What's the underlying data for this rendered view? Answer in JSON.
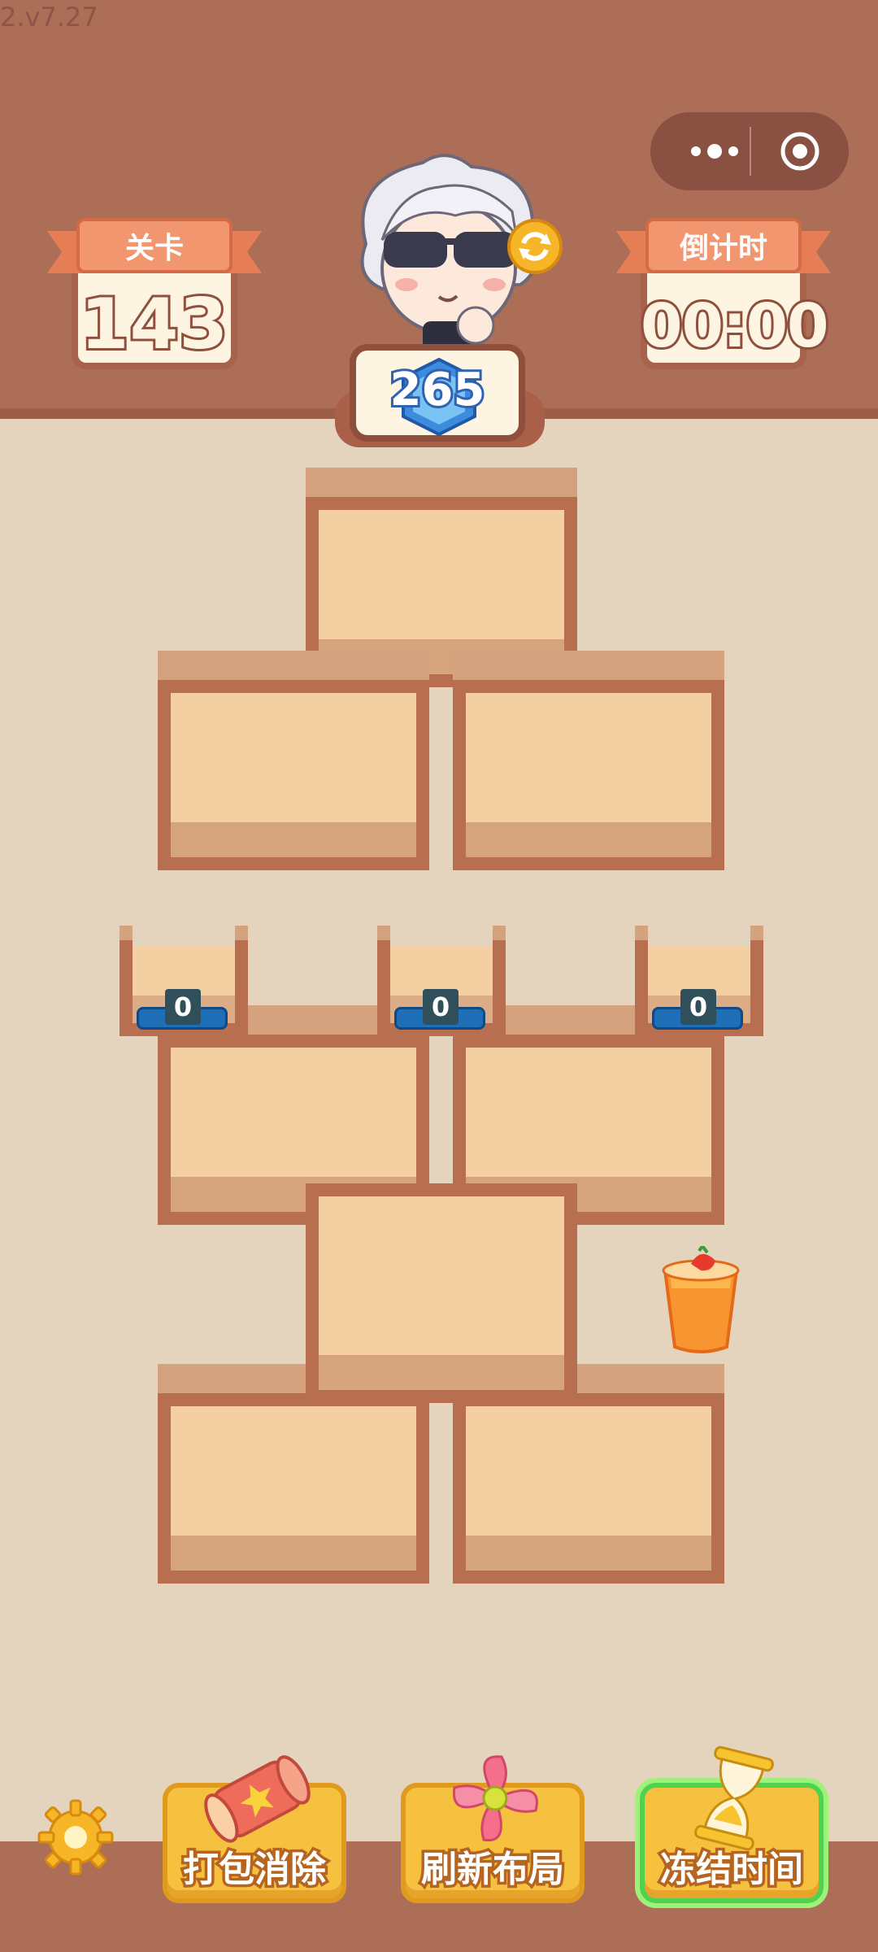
{
  "version": "2.v7.27",
  "level": {
    "label": "关卡",
    "value": "143"
  },
  "countdown": {
    "label": "倒计时",
    "value": "00:00"
  },
  "score": {
    "value": "265"
  },
  "capsule_icons": [
    "more-dots-icon",
    "target-circle-icon"
  ],
  "slots": [
    {
      "count": "0"
    },
    {
      "count": "0"
    },
    {
      "count": "0"
    }
  ],
  "tools": [
    {
      "label": "打包消除",
      "icon": "scroll-icon"
    },
    {
      "label": "刷新布局",
      "icon": "pinwheel-icon"
    },
    {
      "label": "冻结时间",
      "icon": "hourglass-icon",
      "active": true
    }
  ],
  "colors": {
    "header": "#ad6e58",
    "board": "#e4d4be",
    "box_frame": "#b86f4f",
    "box_inner": "#f4cfa1",
    "tool_button": "#f5c13f",
    "badge": "#1f6fb8"
  }
}
